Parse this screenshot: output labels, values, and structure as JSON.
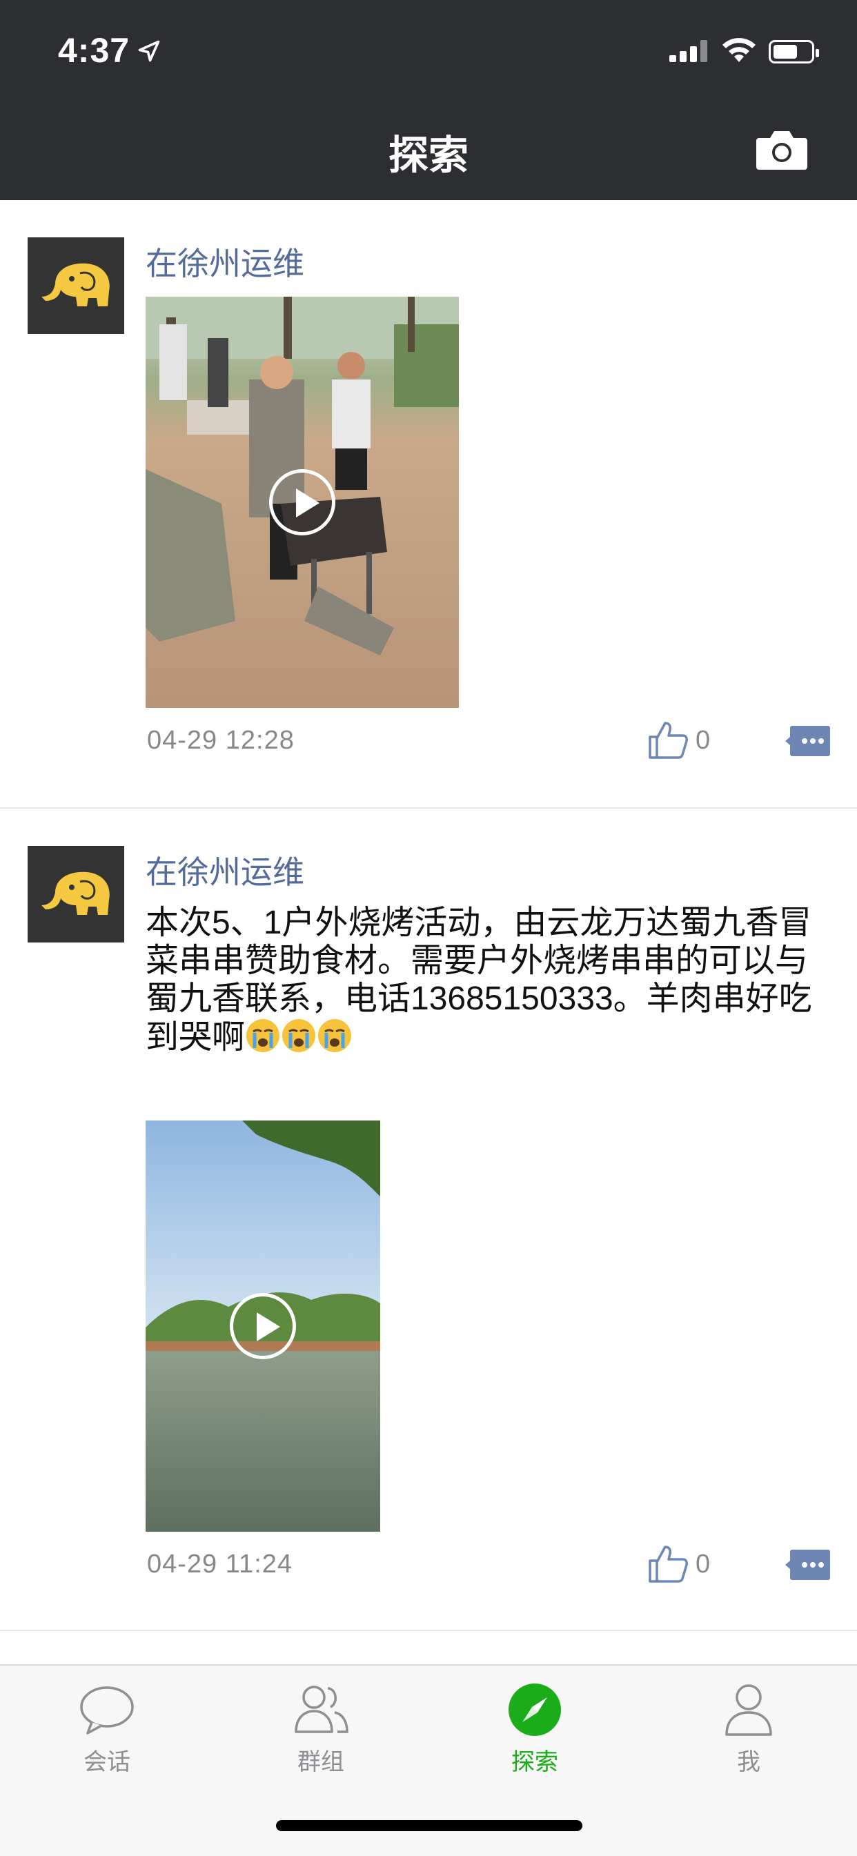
{
  "status_bar": {
    "time": "4:37"
  },
  "header": {
    "title": "探索"
  },
  "posts": [
    {
      "author": "在徐州运维",
      "text": "",
      "timestamp": "04-29 12:28",
      "likes": "0"
    },
    {
      "author": "在徐州运维",
      "text": "本次5、1户外烧烤活动，由云龙万达蜀九香冒菜串串赞助食材。需要户外烧烤串串的可以与蜀九香联系，电话13685150333。羊肉串好吃到哭啊",
      "timestamp": "04-29 11:24",
      "likes": "0"
    }
  ],
  "tabs": [
    {
      "label": "会话",
      "icon": "chat-bubble-icon"
    },
    {
      "label": "群组",
      "icon": "group-icon"
    },
    {
      "label": "探索",
      "icon": "compass-icon",
      "active": true
    },
    {
      "label": "我",
      "icon": "person-icon"
    }
  ],
  "colors": {
    "header_bg": "#2d2e32",
    "author": "#546b9a",
    "active_tab": "#1aad19",
    "timestamp": "#888888"
  }
}
